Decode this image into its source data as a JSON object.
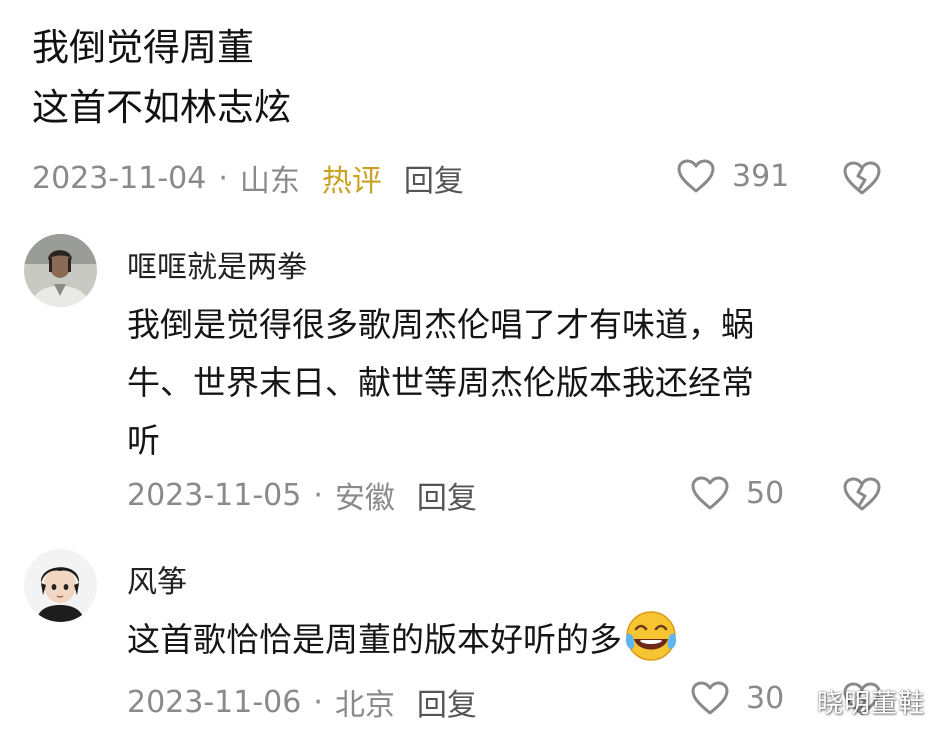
{
  "top_comment": {
    "lines": [
      "我倒觉得周董",
      "这首不如林志炫"
    ],
    "date": "2023-11-04",
    "location": "山东",
    "hot_label": "热评",
    "reply_label": "回复",
    "likes": "391"
  },
  "replies": [
    {
      "username": "哐哐就是两拳",
      "lines": [
        "我倒是觉得很多歌周杰伦唱了才有味道，蜗",
        "牛、世界末日、献世等周杰伦版本我还经常",
        "听"
      ],
      "date": "2023-11-05",
      "location": "安徽",
      "reply_label": "回复",
      "likes": "50"
    },
    {
      "username": "风筝",
      "lines": [
        "这首歌恰恰是周董的版本好听的多"
      ],
      "date": "2023-11-06",
      "location": "北京",
      "reply_label": "回复",
      "likes": "30"
    }
  ],
  "separator": "·",
  "watermark": "晓明董鞋",
  "colors": {
    "hot": "#c9a222",
    "meta": "#8a8a8a",
    "text": "#151515"
  },
  "icons": [
    "heart-outline-icon",
    "broken-heart-icon",
    "laughing-crying-emoji-icon"
  ]
}
